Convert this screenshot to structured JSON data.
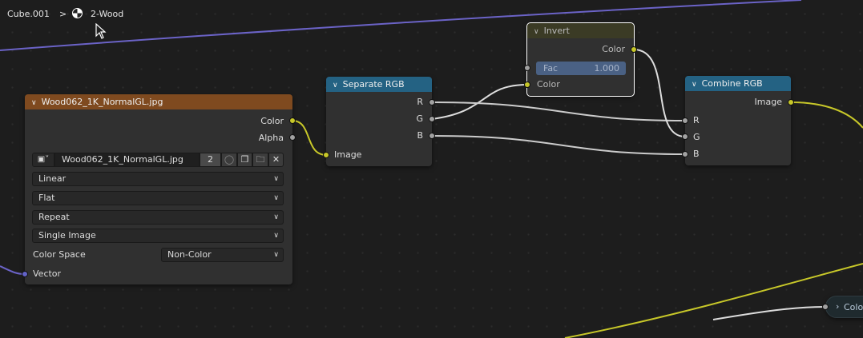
{
  "breadcrumb": {
    "object": "Cube.001",
    "separator": ">",
    "material_icon": "material-sphere-icon",
    "material": "2-Wood"
  },
  "colors": {
    "image_header": "#7f4a1f",
    "converter_header": "#246283",
    "color_header": "#3b3b25",
    "socket_color": "#c7c729",
    "socket_float": "#a1a1a1",
    "socket_vector": "#6363c7"
  },
  "image_node": {
    "title": "Wood062_1K_NormalGL.jpg",
    "outputs": [
      "Color",
      "Alpha"
    ],
    "image_name": "Wood062_1K_NormalGL.jpg",
    "users": "2",
    "interpolation": "Linear",
    "projection": "Flat",
    "extension": "Repeat",
    "source": "Single Image",
    "color_space_label": "Color Space",
    "color_space": "Non-Color",
    "input": "Vector"
  },
  "separate_node": {
    "title": "Separate RGB",
    "outputs": [
      "R",
      "G",
      "B"
    ],
    "input": "Image"
  },
  "invert_node": {
    "title": "Invert",
    "output": "Color",
    "fac_label": "Fac",
    "fac_value": "1.000",
    "input": "Color"
  },
  "combine_node": {
    "title": "Combine RGB",
    "output": "Image",
    "inputs": [
      "R",
      "G",
      "B"
    ]
  },
  "reroute_node": {
    "label": "Color"
  }
}
